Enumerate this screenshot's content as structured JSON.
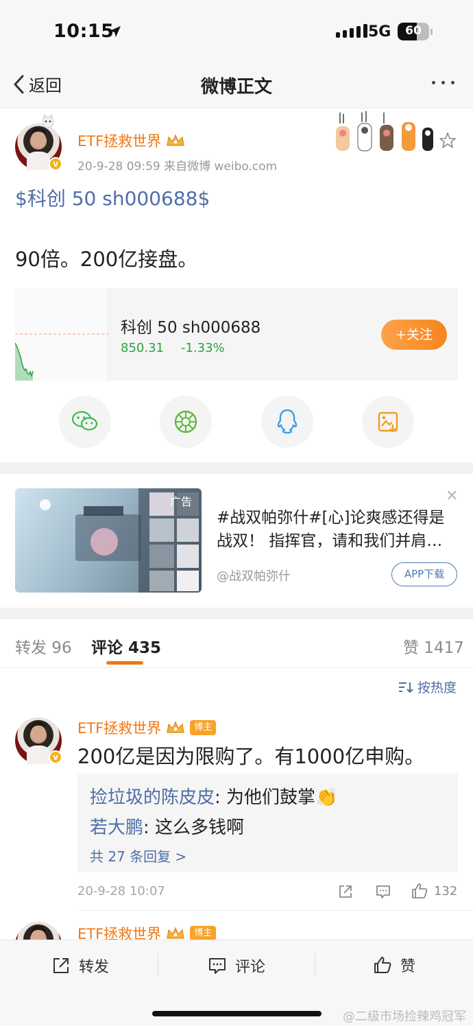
{
  "status_bar": {
    "time": "10:15",
    "network": "5G",
    "battery": "60",
    "battery_level": 0.6
  },
  "nav": {
    "back_label": "返回",
    "title": "微博正文"
  },
  "post": {
    "author": "ETF拯救世界",
    "meta": "20-9-28 09:59  来自微博 weibo.com",
    "stock_tag": "$科创 50 sh000688$",
    "text": "90倍。200亿接盘。",
    "stock_card": {
      "name": "科创 50 sh000688",
      "price": "850.31",
      "change": "-1.33%",
      "follow_label": "+关注",
      "price_color": "#27a33f"
    },
    "share_icons": [
      "wechat-icon",
      "moments-icon",
      "qq-icon",
      "save-image-icon"
    ]
  },
  "ad": {
    "tag": "广告",
    "text": "#战双帕弥什#[心]论爽感还得是战双！ 指挥官，请和我们并肩…",
    "source": "@战双帕弥什",
    "button_label": "APP下载"
  },
  "tabs": {
    "repost": "转发 96",
    "comment": "评论 435",
    "like": "赞 1417"
  },
  "sort_label": "按热度",
  "comments": [
    {
      "author": "ETF拯救世界",
      "badge": "博主",
      "text": "200亿是因为限购了。有1000亿申购。",
      "replies": [
        {
          "user": "捡垃圾的陈皮皮",
          "text": ": 为他们鼓掌👏"
        },
        {
          "user": "若大鹏",
          "text": ": 这么多钱啊"
        }
      ],
      "more_replies": "共 27 条回复 >",
      "time": "20-9-28 10:07",
      "likes": "132"
    },
    {
      "author": "ETF拯救世界",
      "badge": "博主"
    }
  ],
  "bottom_bar": {
    "repost": "转发",
    "comment": "评论",
    "like": "赞"
  },
  "watermark": "@二级市场捡辣鸡冠军",
  "colors": {
    "accent": "#f37712",
    "link": "#4e6ea7",
    "positive": "#27a33f"
  }
}
